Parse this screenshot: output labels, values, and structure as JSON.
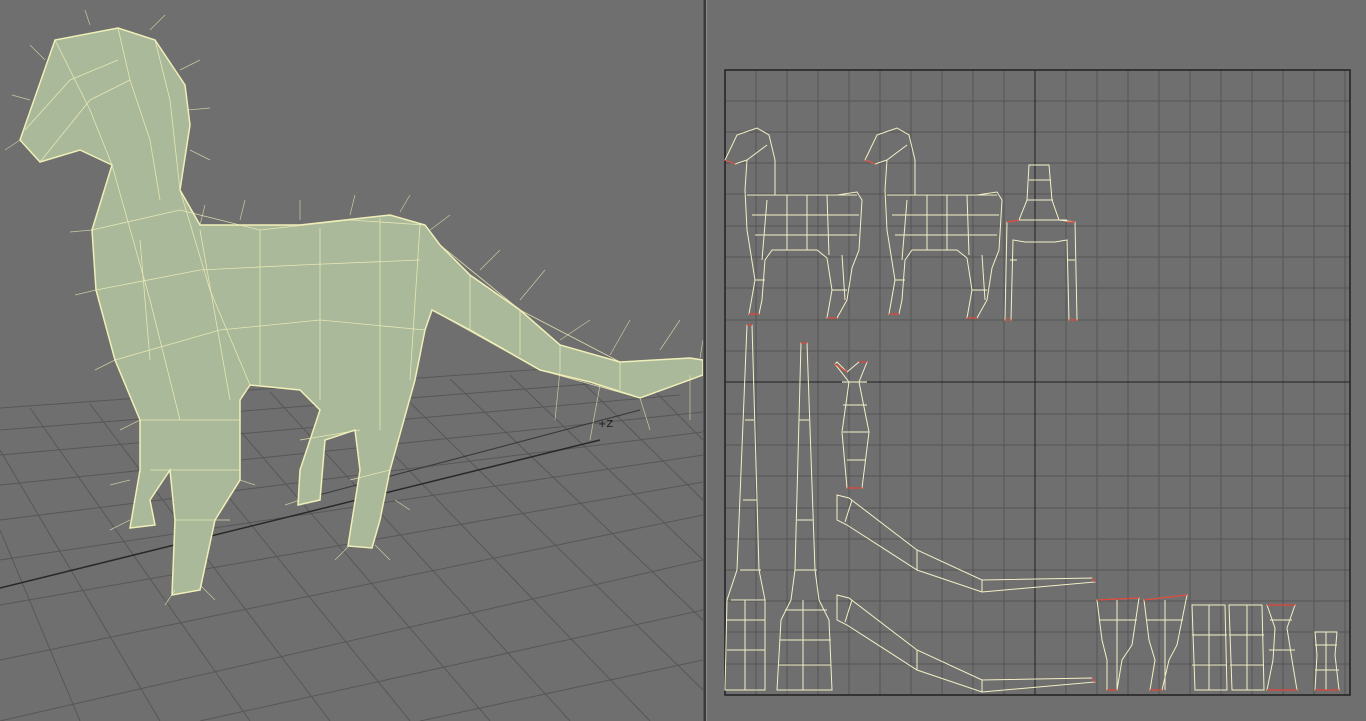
{
  "perspective_view": {
    "axis_label": "+Z"
  },
  "colors": {
    "background": "#6f6f6f",
    "grid_lines": "#555555",
    "mesh_fill": "#a9b99a",
    "wireframe": "#f1efb8",
    "uv_shell_line": "#f3f0c6",
    "uv_border_edge": "#e0453a",
    "uv_frame": "#202020"
  }
}
